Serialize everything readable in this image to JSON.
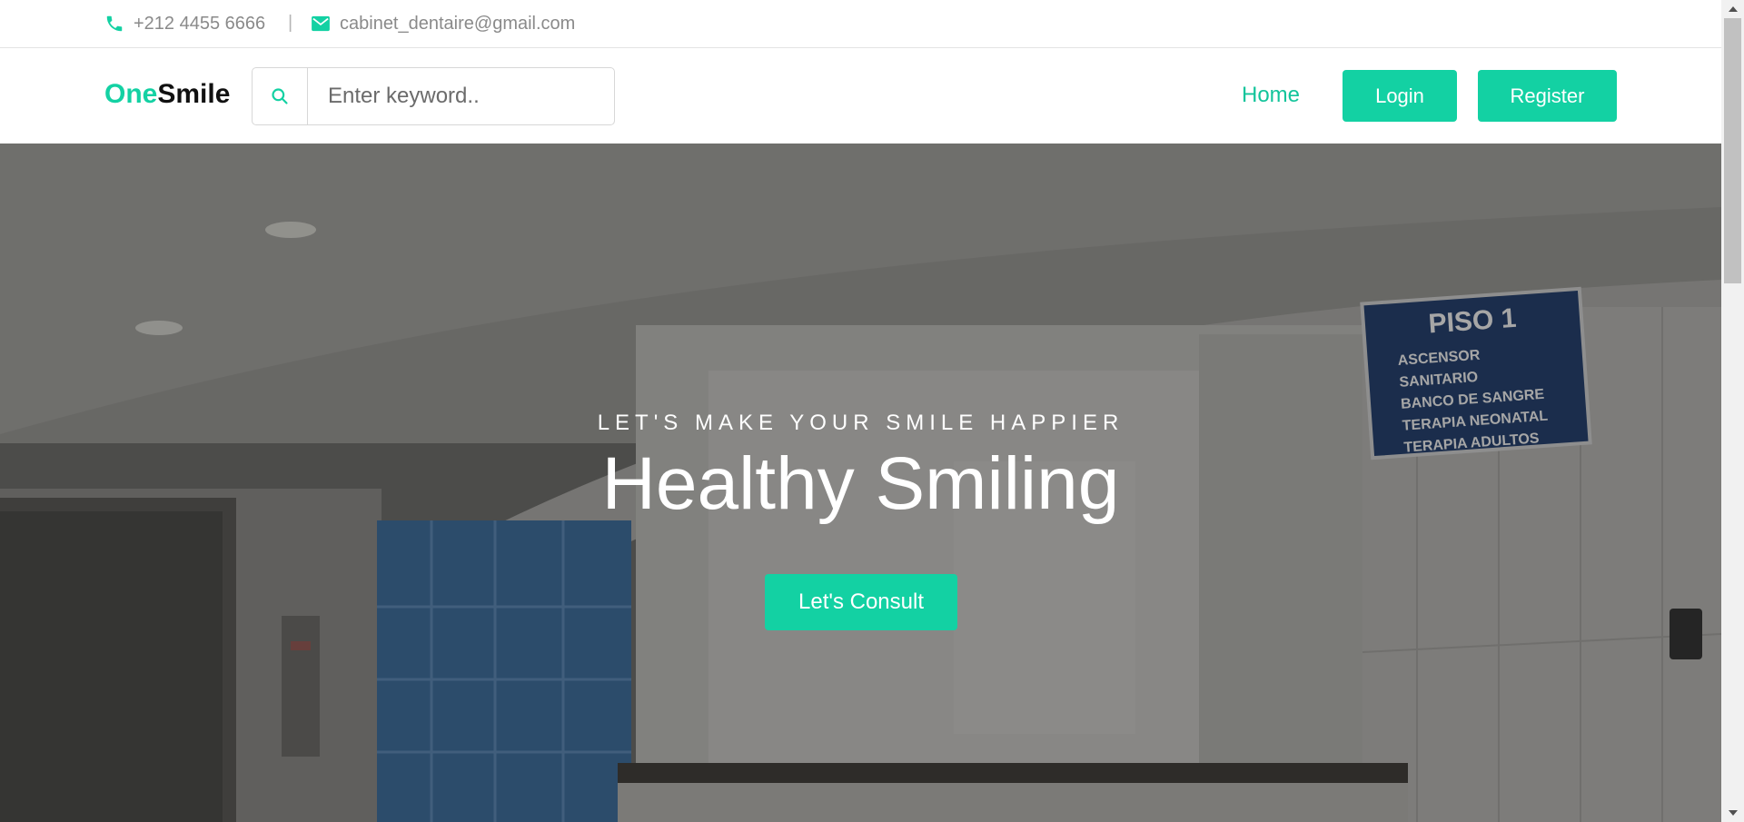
{
  "topbar": {
    "phone": "+212 4455 6666",
    "separator": "|",
    "email": "cabinet_dentaire@gmail.com"
  },
  "navbar": {
    "brand_accent": "One",
    "brand_rest": "Smile",
    "search_placeholder": "Enter keyword..",
    "home_label": "Home",
    "login_label": "Login",
    "register_label": "Register"
  },
  "hero": {
    "subtitle": "LET'S MAKE YOUR SMILE HAPPIER",
    "title": "Healthy Smiling",
    "cta_label": "Let's Consult",
    "sign": {
      "heading": "PISO 1",
      "lines": [
        "ASCENSOR",
        "SANITARIO",
        "BANCO DE SANGRE",
        "TERAPIA NEONATAL",
        "TERAPIA ADULTOS"
      ]
    }
  },
  "colors": {
    "accent": "#13d1a3",
    "accent_text": "#13c49b",
    "muted_text": "#8a8a8a"
  },
  "icons": {
    "phone": "phone-icon",
    "email": "mail-icon",
    "search": "search-icon"
  }
}
